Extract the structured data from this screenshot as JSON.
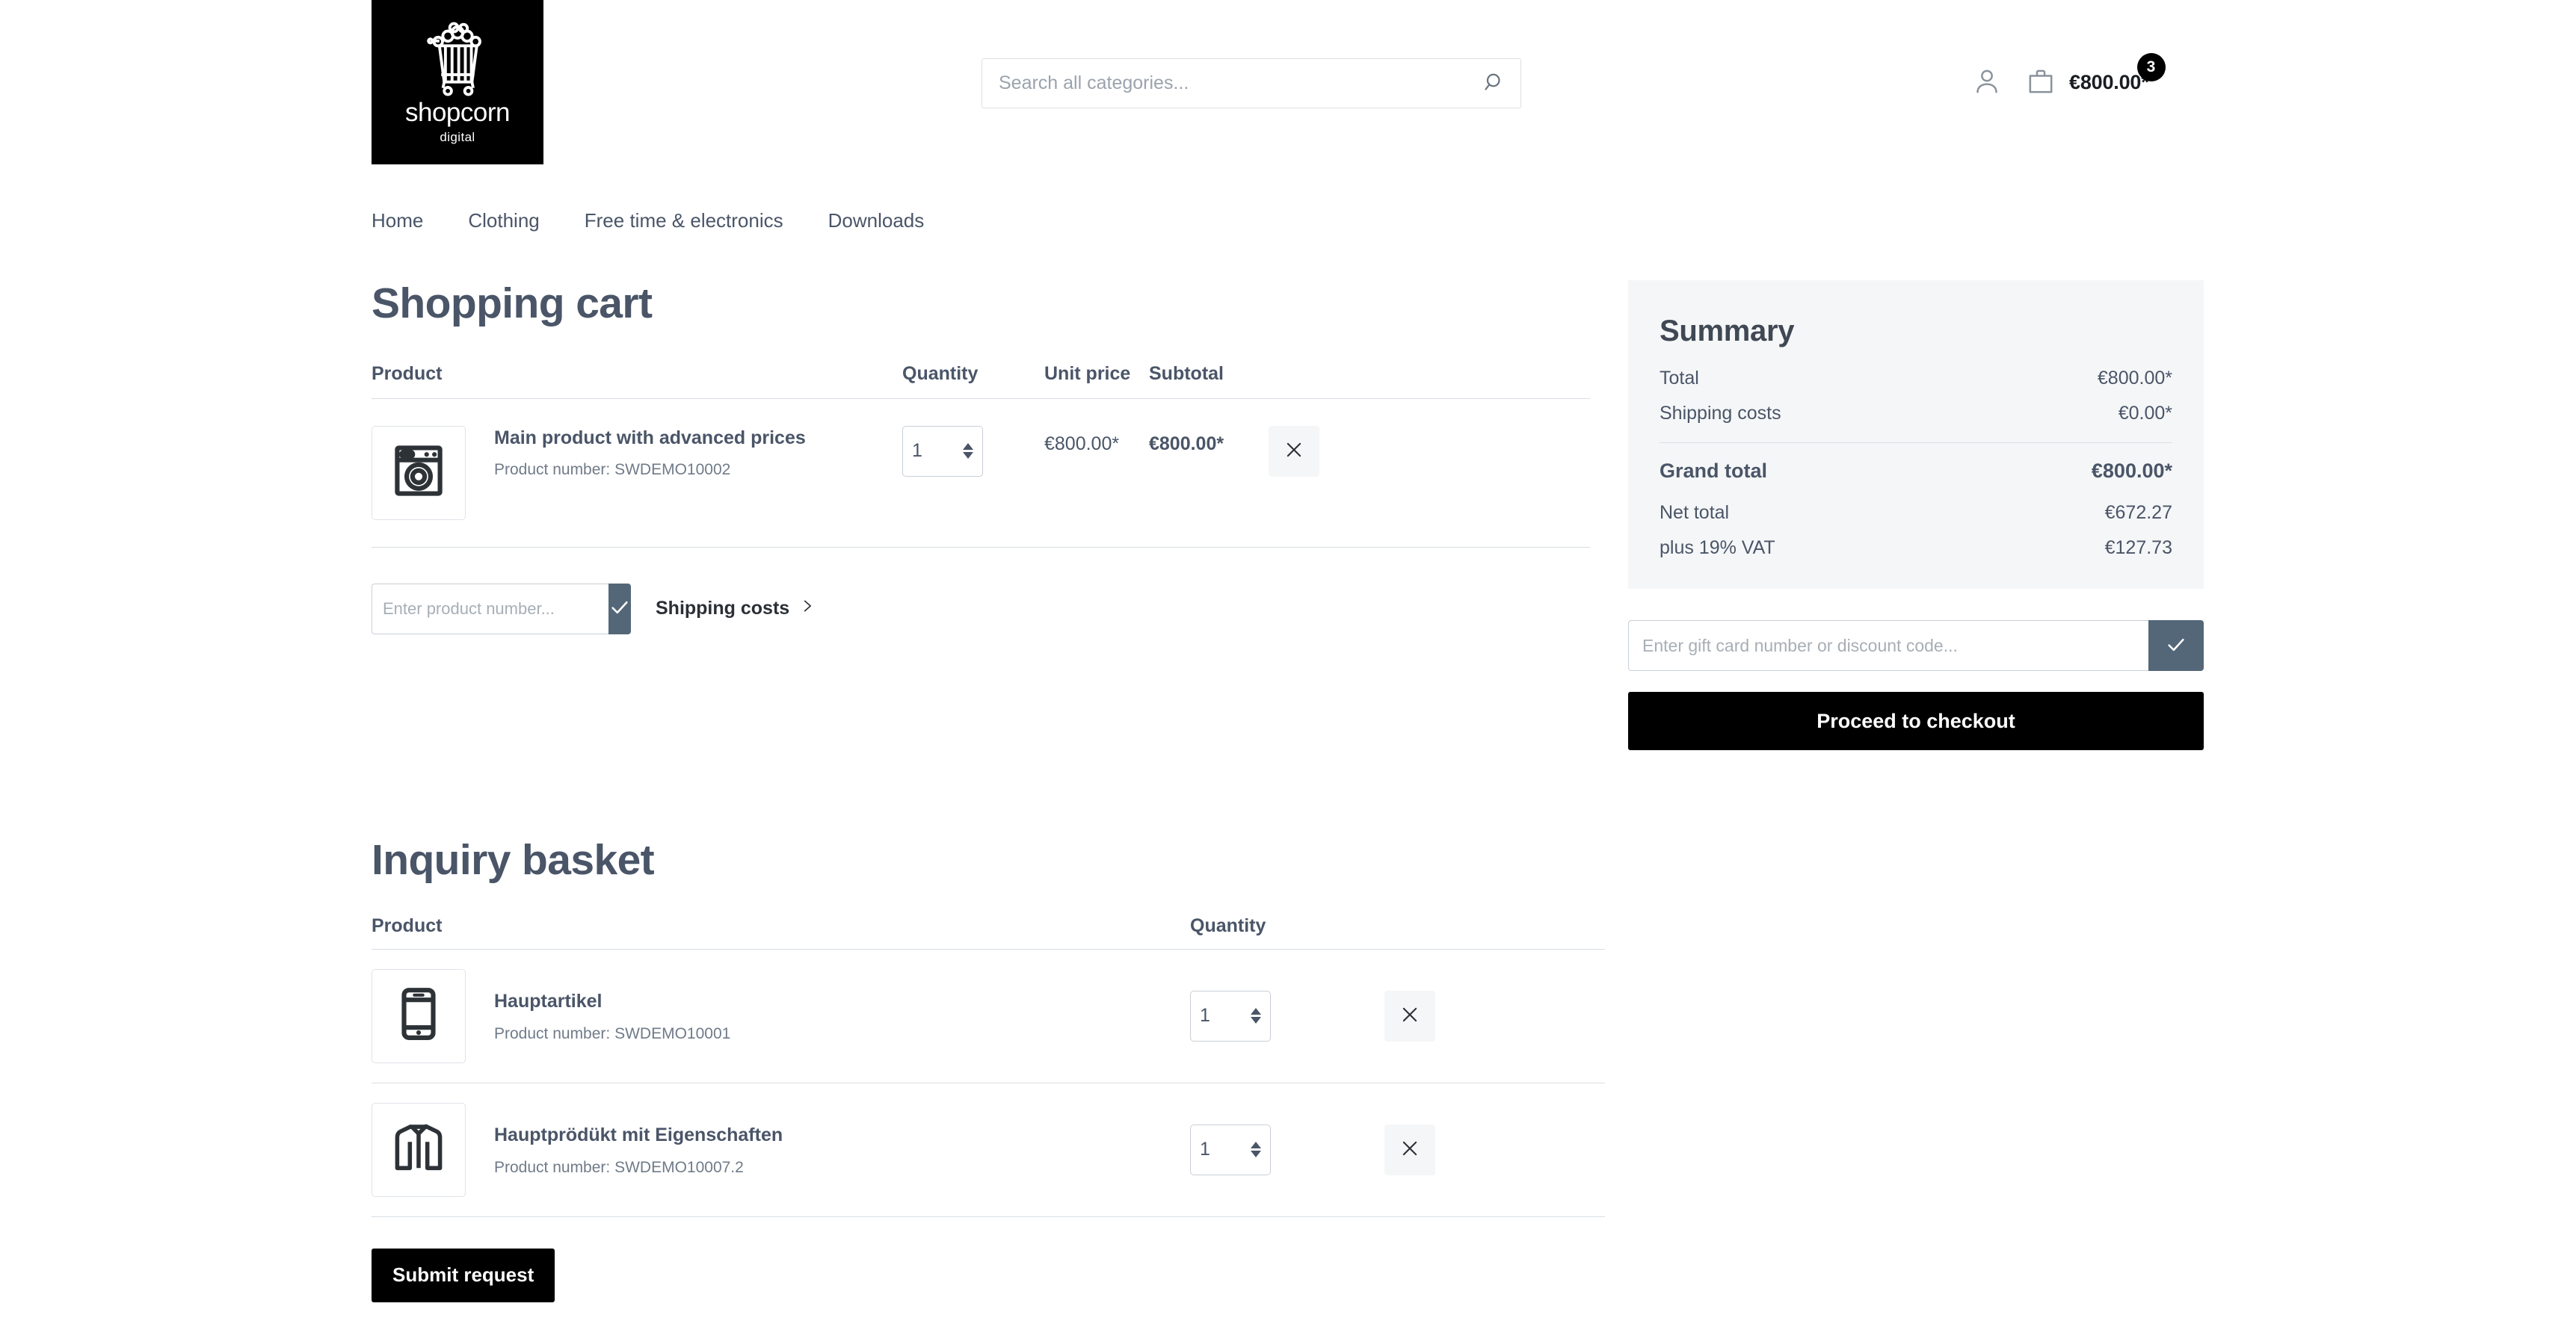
{
  "brand": {
    "name": "shopcorn",
    "tagline": "digital",
    "logo_icon": "popcorn-cart-icon"
  },
  "search": {
    "placeholder": "Search all categories...",
    "value": "",
    "icon": "search-icon"
  },
  "header": {
    "account_icon": "user-icon",
    "cart_icon": "shopping-bag-icon",
    "cart_total": "€800.00*",
    "cart_count": "3"
  },
  "nav": {
    "items": [
      {
        "label": "Home"
      },
      {
        "label": "Clothing"
      },
      {
        "label": "Free time & electronics"
      },
      {
        "label": "Downloads"
      }
    ]
  },
  "cart": {
    "title": "Shopping cart",
    "columns": {
      "product": "Product",
      "quantity": "Quantity",
      "unit_price": "Unit price",
      "subtotal": "Subtotal"
    },
    "rows": [
      {
        "icon": "washing-machine-icon",
        "name": "Main product with advanced prices",
        "product_number": "Product number: SWDEMO10002",
        "quantity": "1",
        "unit_price": "€800.00*",
        "subtotal": "€800.00*",
        "remove_icon": "close-icon"
      }
    ],
    "product_number_placeholder": "Enter product number...",
    "product_number_value": "",
    "submit_icon": "check-icon",
    "shipping_costs_link": "Shipping costs",
    "shipping_chevron": "chevron-right-icon"
  },
  "inquiry": {
    "title": "Inquiry basket",
    "columns": {
      "product": "Product",
      "quantity": "Quantity"
    },
    "rows": [
      {
        "icon": "smartphone-icon",
        "name": "Hauptartikel",
        "product_number": "Product number: SWDEMO10001",
        "quantity": "1",
        "remove_icon": "close-icon"
      },
      {
        "icon": "jacket-icon",
        "name": "Hauptprödükt mit Eigenschaften",
        "product_number": "Product number: SWDEMO10007.2",
        "quantity": "1",
        "remove_icon": "close-icon"
      }
    ],
    "submit_label": "Submit request"
  },
  "summary": {
    "title": "Summary",
    "total_label": "Total",
    "total_value": "€800.00*",
    "shipping_label": "Shipping costs",
    "shipping_value": "€0.00*",
    "grand_label": "Grand total",
    "grand_value": "€800.00*",
    "net_label": "Net total",
    "net_value": "€672.27",
    "vat_label": "plus 19% VAT",
    "vat_value": "€127.73",
    "discount_placeholder": "Enter gift card number or discount code...",
    "discount_value": "",
    "discount_submit_icon": "check-icon",
    "checkout_label": "Proceed to checkout"
  },
  "colors": {
    "accent_slate": "#546778",
    "button_black": "#000000",
    "panel_bg": "#f5f6f7",
    "text": "#4a5568"
  }
}
